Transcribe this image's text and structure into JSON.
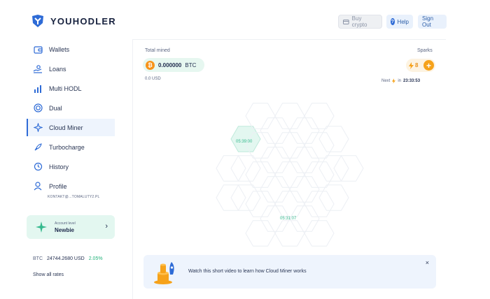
{
  "brand": {
    "name": "YOUHODLER"
  },
  "header": {
    "buy_crypto": "Buy crypto",
    "help": "Help",
    "help_icon": "?",
    "sign_out": "Sign Out"
  },
  "sidebar": {
    "items": [
      {
        "label": "Wallets",
        "icon": "wallet-icon"
      },
      {
        "label": "Loans",
        "icon": "loans-icon"
      },
      {
        "label": "Multi HODL",
        "icon": "chart-bars-icon"
      },
      {
        "label": "Dual",
        "icon": "dual-icon"
      },
      {
        "label": "Cloud Miner",
        "icon": "miner-icon",
        "active": true
      },
      {
        "label": "Turbocharge",
        "icon": "rocket-icon"
      },
      {
        "label": "History",
        "icon": "history-icon"
      },
      {
        "label": "Profile",
        "icon": "user-icon"
      }
    ],
    "profile_email": "KONTAKT@...TOMALUTY2.PL",
    "account": {
      "small_label": "Account level",
      "level": "Newbie"
    },
    "rate": {
      "asset": "BTC",
      "price": "24744.2680 USD",
      "change": "2.05%"
    },
    "show_all_rates": "Show all rates"
  },
  "main": {
    "total_mined_label": "Total mined",
    "mined_value": "0.000000",
    "mined_unit": "BTC",
    "btc_symbol": "₿",
    "mined_usd": "0.0 USD",
    "sparks_label": "Sparks",
    "sparks_count": "8",
    "sparks_add": "+",
    "next_label": "Next",
    "next_in": "in",
    "next_time": "23:33:53",
    "hex_timers": [
      "05:39:00",
      "05:31:07"
    ]
  },
  "banner": {
    "text": "Watch this short video to learn how Cloud Miner works",
    "close": "×"
  },
  "colors": {
    "accent": "#2e6bd6",
    "mint": "#34b98d",
    "orange": "#f6a21a"
  }
}
